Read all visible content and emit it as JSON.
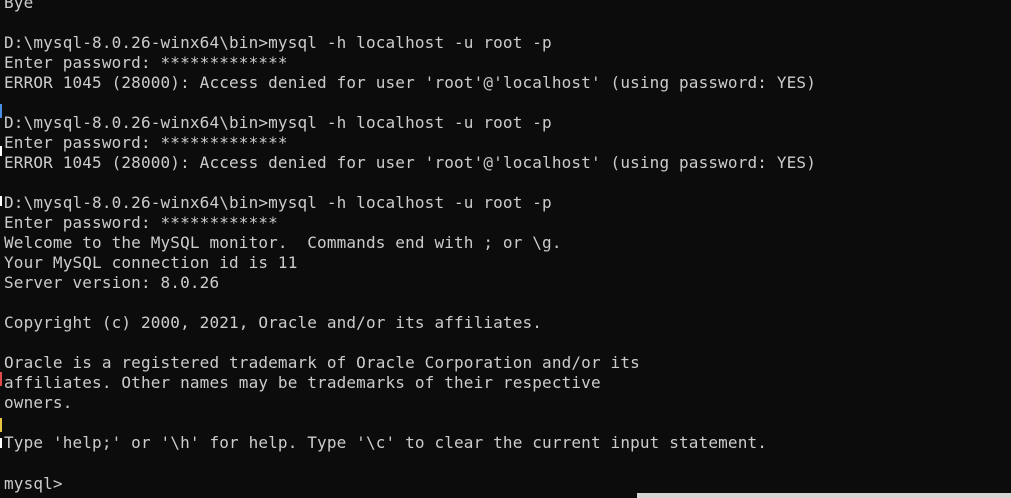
{
  "terminal": {
    "lines": [
      "Bye",
      "",
      "D:\\mysql-8.0.26-winx64\\bin>mysql -h localhost -u root -p",
      "Enter password: *************",
      "ERROR 1045 (28000): Access denied for user 'root'@'localhost' (using password: YES)",
      "",
      "D:\\mysql-8.0.26-winx64\\bin>mysql -h localhost -u root -p",
      "Enter password: *************",
      "ERROR 1045 (28000): Access denied for user 'root'@'localhost' (using password: YES)",
      "",
      "D:\\mysql-8.0.26-winx64\\bin>mysql -h localhost -u root -p",
      "Enter password: ************",
      "Welcome to the MySQL monitor.  Commands end with ; or \\g.",
      "Your MySQL connection id is 11",
      "Server version: 8.0.26",
      "",
      "Copyright (c) 2000, 2021, Oracle and/or its affiliates.",
      "",
      "Oracle is a registered trademark of Oracle Corporation and/or its",
      "affiliates. Other names may be trademarks of their respective",
      "owners.",
      "",
      "Type 'help;' or '\\h' for help. Type '\\c' to clear the current input statement.",
      ""
    ],
    "prompt": "mysql>",
    "colors": {
      "background": "#0c0c0c",
      "foreground": "#cccccc",
      "edge_marks": [
        "#4a8fe7",
        "#e04a4a",
        "#e8c440",
        "#ffffff"
      ]
    }
  }
}
